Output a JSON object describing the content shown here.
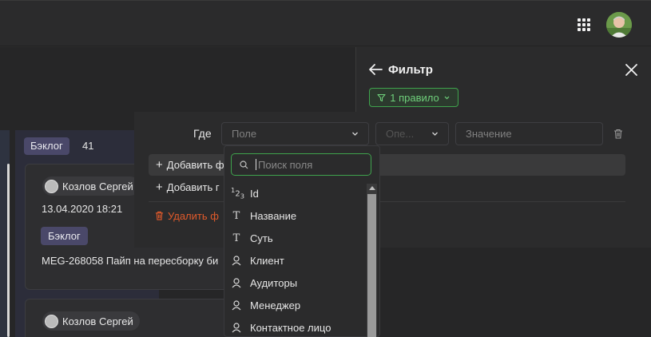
{
  "board": {
    "column_title": "Бэклог",
    "column_count": "41",
    "cards": [
      {
        "assignee": "Козлов Сергей",
        "date": "13.04.2020 18:21",
        "tag": "Бэклог",
        "title": "MEG-268058 Пайп на пересборку би"
      },
      {
        "assignee": "Козлов Сергей"
      }
    ]
  },
  "filter": {
    "title": "Фильтр",
    "rules_label": "1 правило",
    "where_label": "Где",
    "field_placeholder": "Поле",
    "operator_placeholder": "Опе...",
    "value_placeholder": "Значение",
    "add_filter_label": "Добавить ф",
    "add_group_label": "Добавить г",
    "delete_label": "Удалить ф"
  },
  "dropdown": {
    "search_placeholder": "Поиск поля",
    "options": [
      {
        "label": "Id",
        "icon": "number-icon"
      },
      {
        "label": "Название",
        "icon": "text-icon"
      },
      {
        "label": "Суть",
        "icon": "text-icon"
      },
      {
        "label": "Клиент",
        "icon": "user-icon"
      },
      {
        "label": "Аудиторы",
        "icon": "user-icon"
      },
      {
        "label": "Менеджер",
        "icon": "user-icon"
      },
      {
        "label": "Контактное лицо",
        "icon": "user-icon"
      }
    ]
  },
  "colors": {
    "accent_green": "#3fa34d",
    "danger": "#e05a2b",
    "tag_purple": "#4a4869"
  }
}
